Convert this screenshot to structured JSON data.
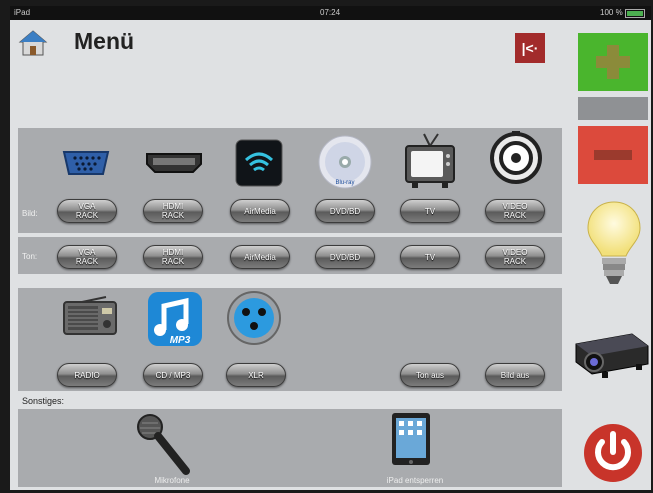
{
  "status": {
    "device": "iPad",
    "time": "07:24",
    "battery": "100 %",
    "battery_color": "#4caf50"
  },
  "header": {
    "title": "Menü"
  },
  "bild": {
    "label": "Bild:",
    "buttons": [
      "VGA\nRACK",
      "HDMI\nRACK",
      "AirMedia",
      "DVD/BD",
      "TV",
      "VIDEO\nRACK"
    ]
  },
  "ton": {
    "label": "Ton:",
    "buttons": [
      "VGA\nRACK",
      "HDMI\nRACK",
      "AirMedia",
      "DVD/BD",
      "TV",
      "VIDEO\nRACK"
    ]
  },
  "audio": {
    "buttons": [
      "RADIO",
      "CD / MP3",
      "XLR",
      "Ton aus",
      "Bild aus"
    ],
    "mp3_text": "MP3"
  },
  "sonstiges": {
    "label": "Sonstiges:",
    "items": [
      "Mikrofone",
      "iPad entsperren"
    ]
  },
  "icons": {
    "home": "home-icon",
    "back": "back-icon",
    "plus": "plus-icon",
    "minus": "minus-icon",
    "bulb": "lightbulb-icon",
    "projector": "projector-icon",
    "power": "power-icon"
  },
  "colors": {
    "plus": "#4ab52d",
    "minus": "#dc4a3c",
    "power": "#c8342a",
    "back": "#a22b2b"
  }
}
